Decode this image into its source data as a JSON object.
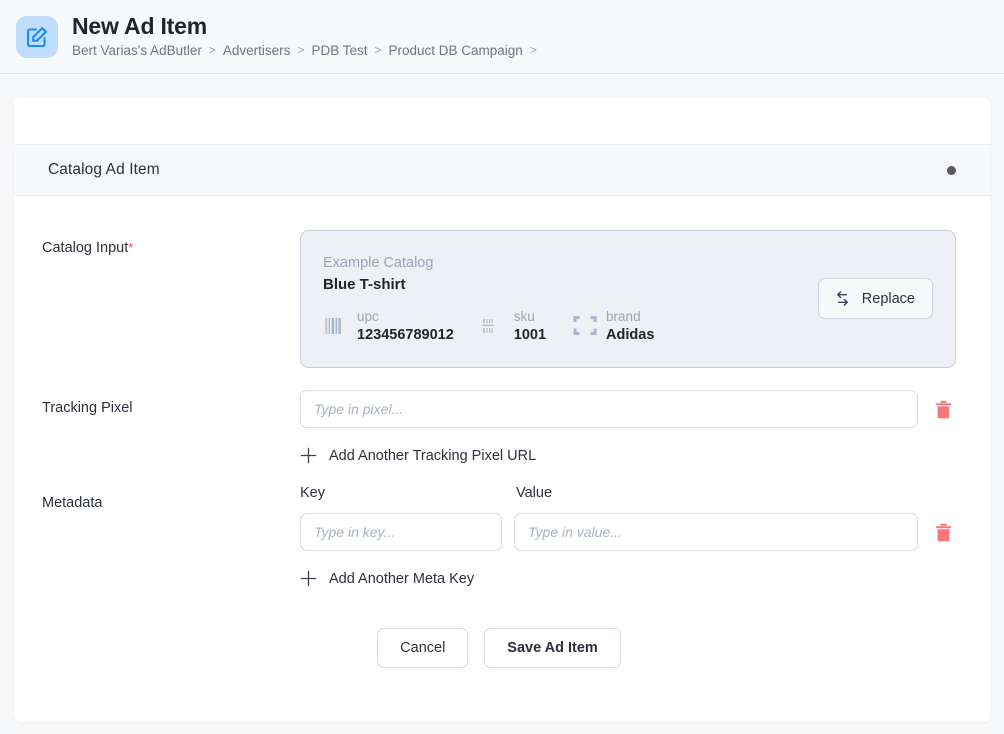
{
  "header": {
    "icon": "compose-edit-icon",
    "title": "New Ad Item",
    "breadcrumb": [
      {
        "label": "Bert Varias's AdButler"
      },
      {
        "label": "Advertisers"
      },
      {
        "label": "PDB Test"
      },
      {
        "label": "Product DB Campaign"
      }
    ],
    "separator": ">"
  },
  "section": {
    "title": "Catalog Ad Item",
    "status_dot_color": "#5b5a60"
  },
  "form": {
    "catalog_input": {
      "label": "Catalog Input",
      "required_marker": "*",
      "card": {
        "source": "Example Catalog",
        "name": "Blue T-shirt",
        "attributes": [
          {
            "icon": "barcode-icon",
            "key": "upc",
            "value": "123456789012"
          },
          {
            "icon": "sku-barcode-icon",
            "key": "sku",
            "value": "1001"
          },
          {
            "icon": "scan-frame-icon",
            "key": "brand",
            "value": "Adidas"
          }
        ],
        "replace_button": {
          "label": "Replace",
          "icon": "swap-arrows-icon"
        }
      }
    },
    "tracking_pixel": {
      "label": "Tracking Pixel",
      "placeholder": "Type in pixel...",
      "value": "",
      "delete_icon": "trash-icon",
      "add_label": "Add Another Tracking Pixel URL",
      "add_icon": "plus-icon"
    },
    "metadata": {
      "label": "Metadata",
      "key_header": "Key",
      "value_header": "Value",
      "key_placeholder": "Type in key...",
      "key_value": "",
      "value_placeholder": "Type in value...",
      "value_value": "",
      "delete_icon": "trash-icon",
      "add_label": "Add Another Meta Key",
      "add_icon": "plus-icon"
    }
  },
  "actions": {
    "cancel_label": "Cancel",
    "save_label": "Save Ad Item"
  },
  "colors": {
    "accent_blue": "#1a8cff",
    "icon_tile": "#bfdcfb",
    "danger": "#f4787c",
    "required": "#ef4a52",
    "card_bg": "#eef0f6",
    "card_border": "#c6ccdb"
  }
}
